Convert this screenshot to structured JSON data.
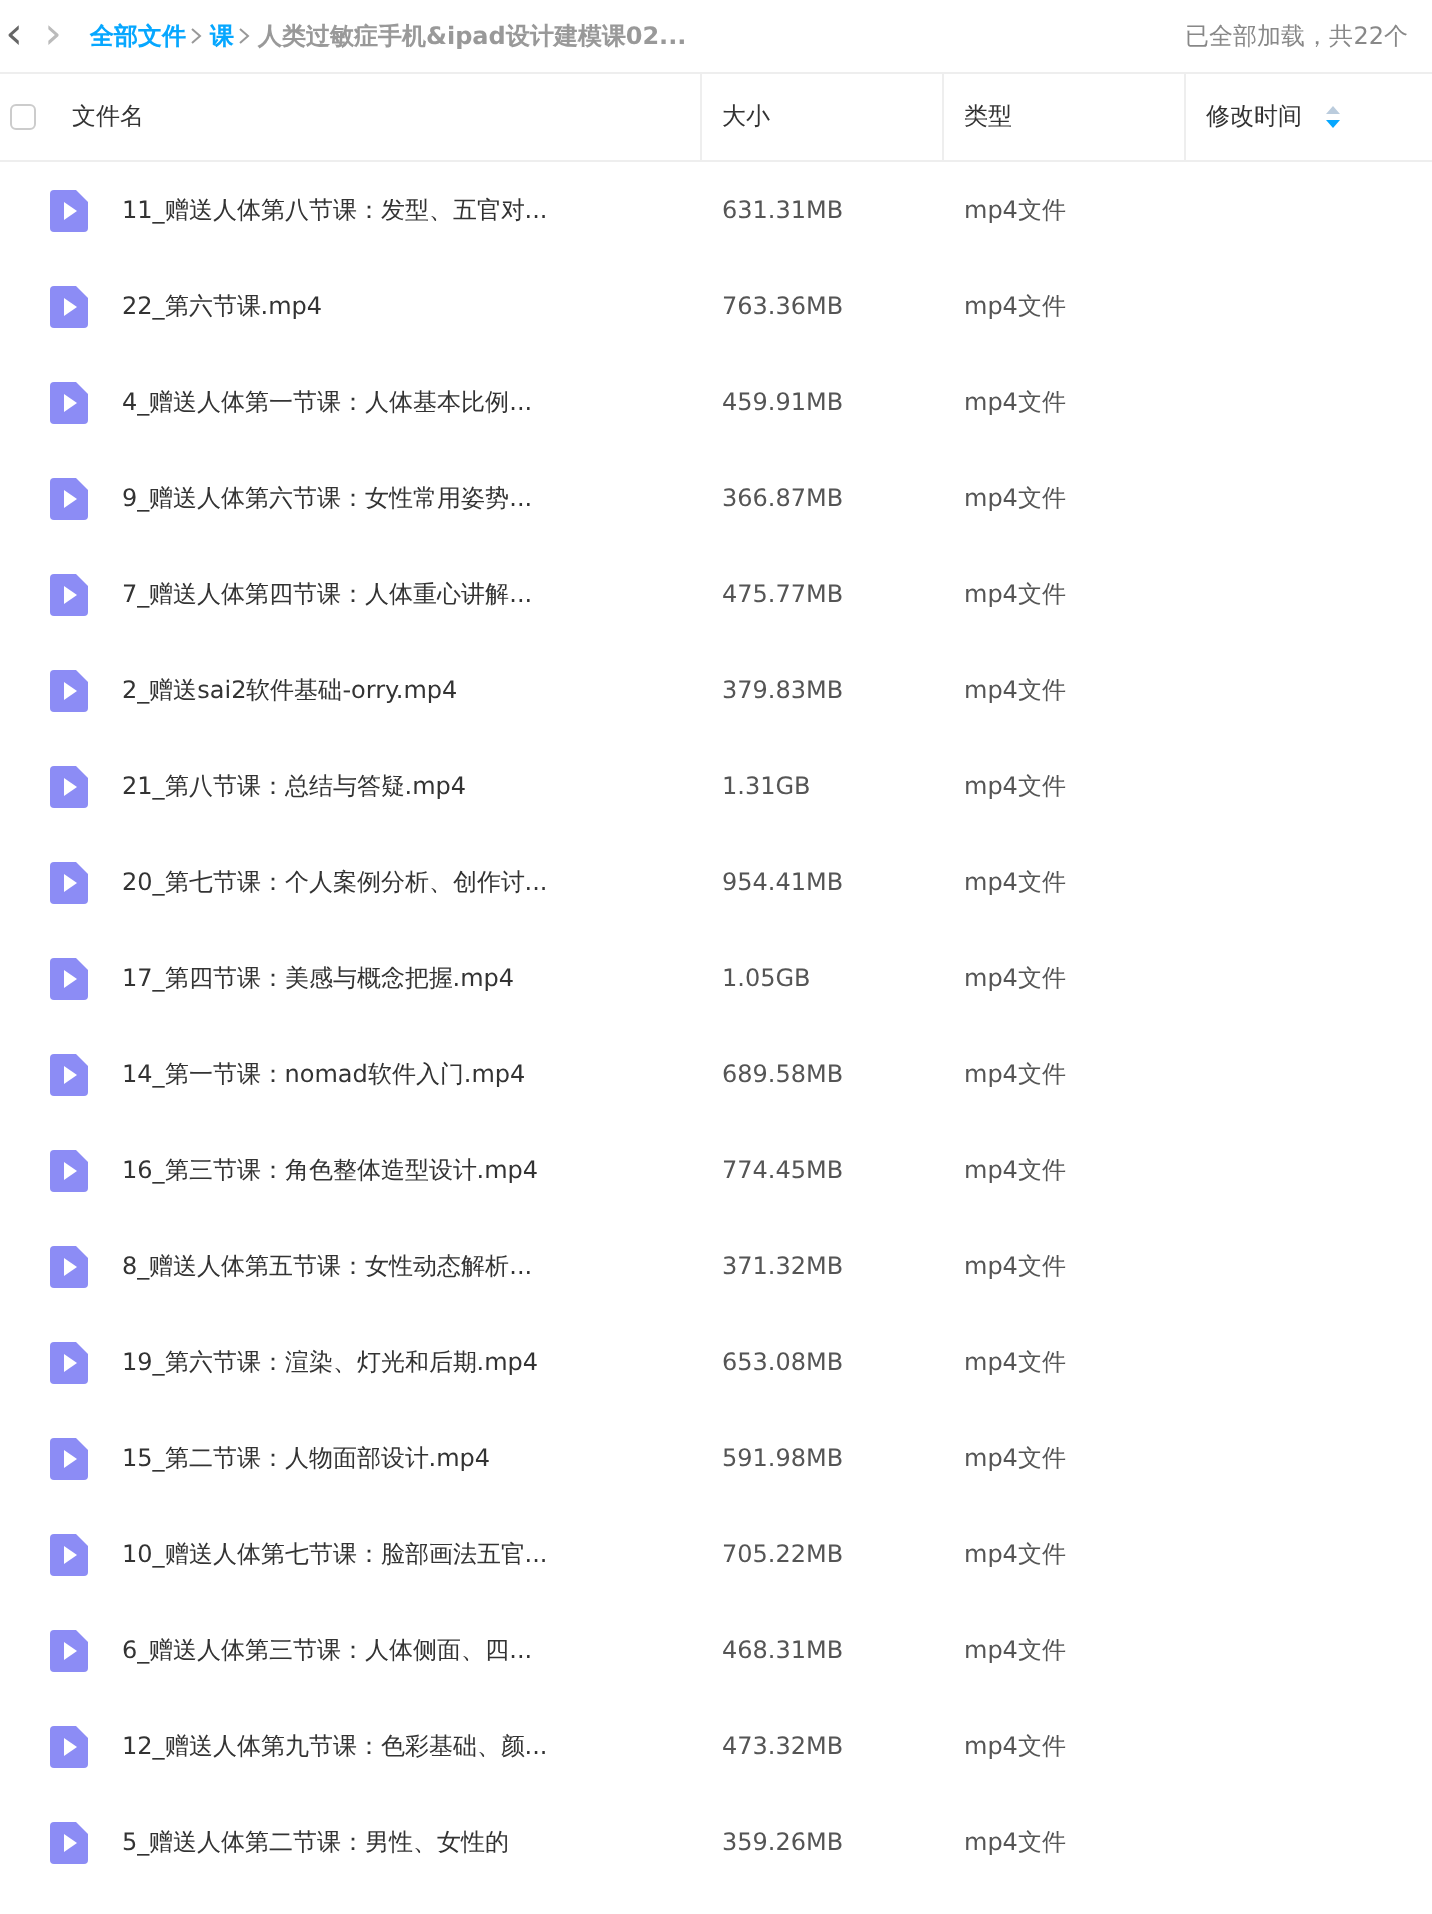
{
  "nav": {
    "back": "‹",
    "forward": "›"
  },
  "breadcrumb": [
    {
      "label": "全部文件",
      "link": true
    },
    {
      "label": "课",
      "link": true
    },
    {
      "label": "人类过敏症手机&ipad设计建模课02...",
      "link": false
    }
  ],
  "load_status": "已全部加载，共22个",
  "table": {
    "select_all_checked": false,
    "columns": [
      {
        "label": "文件名",
        "sortable": false
      },
      {
        "label": "大小",
        "sortable": false
      },
      {
        "label": "类型",
        "sortable": false
      },
      {
        "label": "修改时间",
        "sortable": true
      }
    ],
    "rows": [
      {
        "name": "11_赠送人体第八节课：发型、五官对...",
        "size": "631.31MB",
        "type": "mp4文件"
      },
      {
        "name": "22_第六节课.mp4",
        "size": "763.36MB",
        "type": "mp4文件"
      },
      {
        "name": "4_赠送人体第一节课：人体基本比例...",
        "size": "459.91MB",
        "type": "mp4文件"
      },
      {
        "name": "9_赠送人体第六节课：女性常用姿势...",
        "size": "366.87MB",
        "type": "mp4文件"
      },
      {
        "name": "7_赠送人体第四节课：人体重心讲解...",
        "size": "475.77MB",
        "type": "mp4文件"
      },
      {
        "name": "2_赠送sai2软件基础-orry.mp4",
        "size": "379.83MB",
        "type": "mp4文件"
      },
      {
        "name": "21_第八节课：总结与答疑.mp4",
        "size": "1.31GB",
        "type": "mp4文件"
      },
      {
        "name": "20_第七节课：个人案例分析、创作讨...",
        "size": "954.41MB",
        "type": "mp4文件"
      },
      {
        "name": "17_第四节课：美感与概念把握.mp4",
        "size": "1.05GB",
        "type": "mp4文件"
      },
      {
        "name": "14_第一节课：nomad软件入门.mp4",
        "size": "689.58MB",
        "type": "mp4文件"
      },
      {
        "name": "16_第三节课：角色整体造型设计.mp4",
        "size": "774.45MB",
        "type": "mp4文件"
      },
      {
        "name": "8_赠送人体第五节课：女性动态解析...",
        "size": "371.32MB",
        "type": "mp4文件"
      },
      {
        "name": "19_第六节课：渲染、灯光和后期.mp4",
        "size": "653.08MB",
        "type": "mp4文件"
      },
      {
        "name": "15_第二节课：人物面部设计.mp4",
        "size": "591.98MB",
        "type": "mp4文件"
      },
      {
        "name": "10_赠送人体第七节课：脸部画法五官...",
        "size": "705.22MB",
        "type": "mp4文件"
      },
      {
        "name": "6_赠送人体第三节课：人体侧面、四...",
        "size": "468.31MB",
        "type": "mp4文件"
      },
      {
        "name": "12_赠送人体第九节课：色彩基础、颜...",
        "size": "473.32MB",
        "type": "mp4文件"
      },
      {
        "name": "5_赠送人体第二节课：男性、女性的",
        "size": "359.26MB",
        "type": "mp4文件"
      }
    ]
  }
}
